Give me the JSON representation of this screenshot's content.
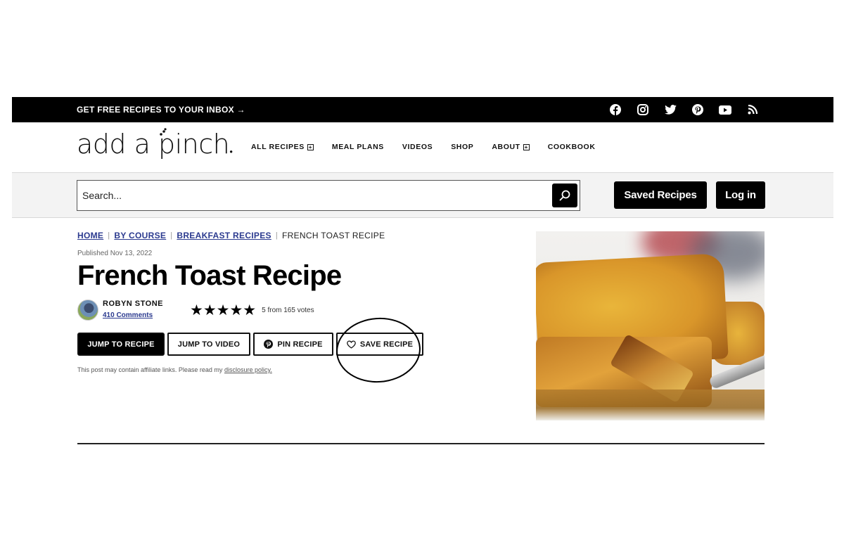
{
  "topbar": {
    "promo": "GET FREE RECIPES TO YOUR INBOX →",
    "social": [
      {
        "name": "facebook-icon"
      },
      {
        "name": "instagram-icon"
      },
      {
        "name": "twitter-icon"
      },
      {
        "name": "pinterest-icon"
      },
      {
        "name": "youtube-icon"
      },
      {
        "name": "rss-icon"
      }
    ]
  },
  "header": {
    "logo_text": "add a pinch",
    "nav": [
      {
        "label": "ALL RECIPES",
        "has_submenu": true
      },
      {
        "label": "MEAL PLANS",
        "has_submenu": false
      },
      {
        "label": "VIDEOS",
        "has_submenu": false
      },
      {
        "label": "SHOP",
        "has_submenu": false
      },
      {
        "label": "ABOUT",
        "has_submenu": true
      },
      {
        "label": "COOKBOOK",
        "has_submenu": false
      }
    ],
    "submenu_glyph": "+"
  },
  "searchbar": {
    "placeholder": "Search...",
    "value": "",
    "saved_recipes_label": "Saved Recipes",
    "login_label": "Log in"
  },
  "breadcrumb": {
    "items": [
      "HOME",
      "BY COURSE",
      "BREAKFAST RECIPES"
    ],
    "separator": "|",
    "current": "FRENCH TOAST RECIPE"
  },
  "post": {
    "published": "Published Nov 13, 2022",
    "title": "French Toast Recipe",
    "author": "ROBYN STONE",
    "comments": "410 Comments",
    "rating": {
      "value": 5,
      "max": 5,
      "votes_text": "5 from 165 votes",
      "star_glyph": "★"
    },
    "buttons": {
      "jump_recipe": "JUMP TO RECIPE",
      "jump_video": "JUMP TO VIDEO",
      "pin_recipe": "PIN RECIPE",
      "save_recipe": "SAVE RECIPE"
    },
    "disclaimer_text": "This post may contain affiliate links. Please read my ",
    "disclaimer_link": "disclosure policy."
  },
  "colors": {
    "link_blue": "#2b3a8f",
    "black": "#000000",
    "search_bg": "#f3f3f3"
  }
}
